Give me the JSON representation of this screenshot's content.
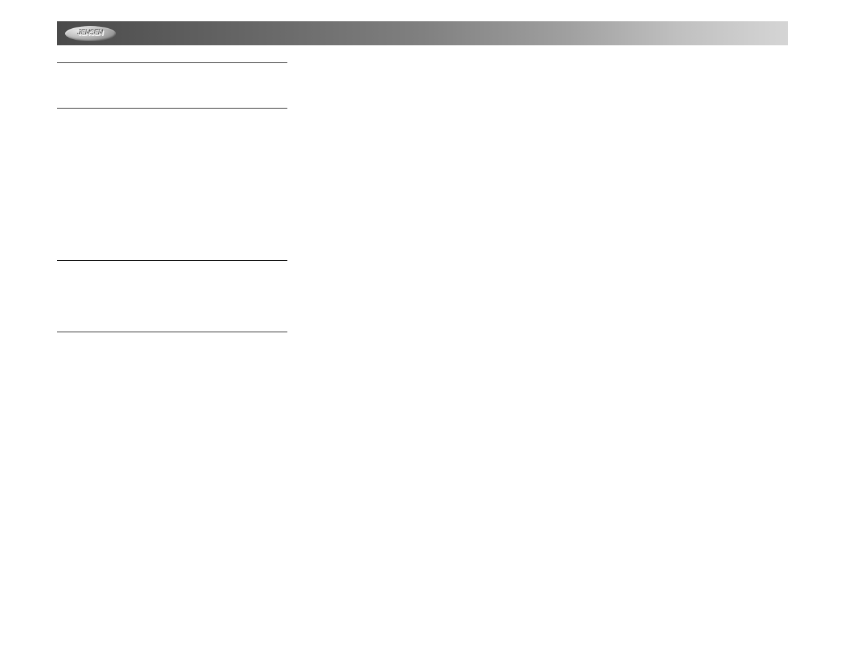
{
  "header": {
    "brand": "JENSEN"
  }
}
